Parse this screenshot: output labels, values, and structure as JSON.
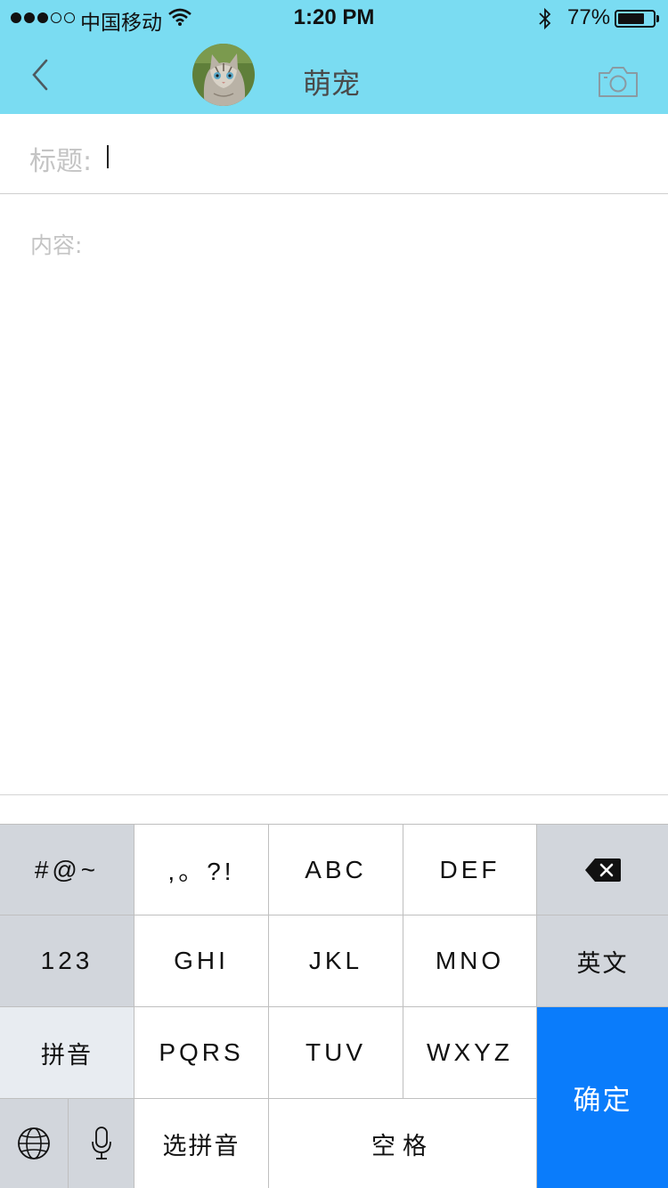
{
  "status_bar": {
    "carrier": "中国移动",
    "time": "1:20 PM",
    "battery_percent": "77%",
    "battery_level": 0.77,
    "signal_bars": 3,
    "signal_total": 5
  },
  "nav": {
    "title": "萌宠",
    "back_icon": "chevron-left-icon",
    "camera_icon": "camera-icon",
    "avatar": "cat-avatar"
  },
  "form": {
    "title_label": "标题:",
    "title_value": "",
    "content_label": "内容:",
    "content_value": ""
  },
  "keyboard": {
    "row1": [
      "#@~",
      ",。?!",
      "ABC",
      "DEF"
    ],
    "delete_icon": "backspace-icon",
    "row2": [
      "123",
      "GHI",
      "JKL",
      "MNO",
      "英文"
    ],
    "row3": [
      "拼音",
      "PQRS",
      "TUV",
      "WXYZ"
    ],
    "confirm": "确定",
    "globe_icon": "globe-icon",
    "mic_icon": "microphone-icon",
    "select_pinyin": "选拼音",
    "space": "空格"
  },
  "colors": {
    "header_bg": "#7adcf2",
    "confirm_blue": "#0a7cfb",
    "placeholder_gray": "#c4c4c4"
  }
}
